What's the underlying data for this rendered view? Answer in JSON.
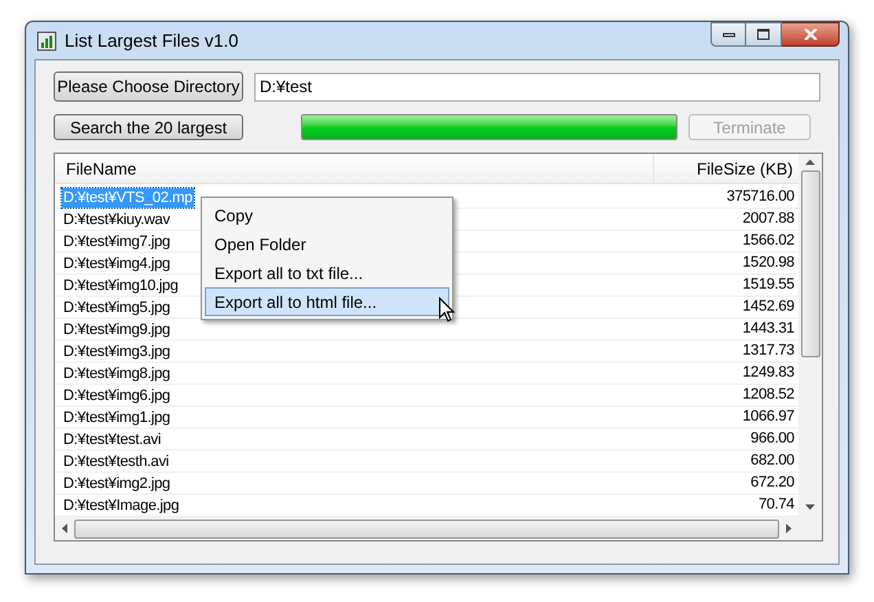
{
  "window": {
    "title": "List Largest Files v1.0"
  },
  "choose_button": "Please Choose Directory",
  "directory": "D:¥test",
  "search_button": "Search the 20 largest",
  "progress": {
    "level": 1
  },
  "terminate_button": {
    "label": "Terminate",
    "disabled": true
  },
  "table": {
    "columns": [
      "FileName",
      "FileSize (KB)"
    ],
    "rows": [
      {
        "name": "D:¥test¥VTS_02.mp",
        "size": "375716.00",
        "selected": true
      },
      {
        "name": "D:¥test¥kiuy.wav",
        "size": "2007.88",
        "selected": false
      },
      {
        "name": "D:¥test¥img7.jpg",
        "size": "1566.02",
        "selected": false
      },
      {
        "name": "D:¥test¥img4.jpg",
        "size": "1520.98",
        "selected": false
      },
      {
        "name": "D:¥test¥img10.jpg",
        "size": "1519.55",
        "selected": false
      },
      {
        "name": "D:¥test¥img5.jpg",
        "size": "1452.69",
        "selected": false
      },
      {
        "name": "D:¥test¥img9.jpg",
        "size": "1443.31",
        "selected": false
      },
      {
        "name": "D:¥test¥img3.jpg",
        "size": "1317.73",
        "selected": false
      },
      {
        "name": "D:¥test¥img8.jpg",
        "size": "1249.83",
        "selected": false
      },
      {
        "name": "D:¥test¥img6.jpg",
        "size": "1208.52",
        "selected": false
      },
      {
        "name": "D:¥test¥img1.jpg",
        "size": "1066.97",
        "selected": false
      },
      {
        "name": "D:¥test¥test.avi",
        "size": "966.00",
        "selected": false
      },
      {
        "name": "D:¥test¥testh.avi",
        "size": "682.00",
        "selected": false
      },
      {
        "name": "D:¥test¥img2.jpg",
        "size": "672.20",
        "selected": false
      },
      {
        "name": "D:¥test¥Image.jpg",
        "size": "70.74",
        "selected": false
      }
    ]
  },
  "context_menu": {
    "items": [
      {
        "label": "Copy",
        "selected": false
      },
      {
        "label": "Open Folder",
        "selected": false
      },
      {
        "label": "Export all to txt file...",
        "selected": false
      },
      {
        "label": "Export all to html file...",
        "selected": true
      }
    ]
  }
}
